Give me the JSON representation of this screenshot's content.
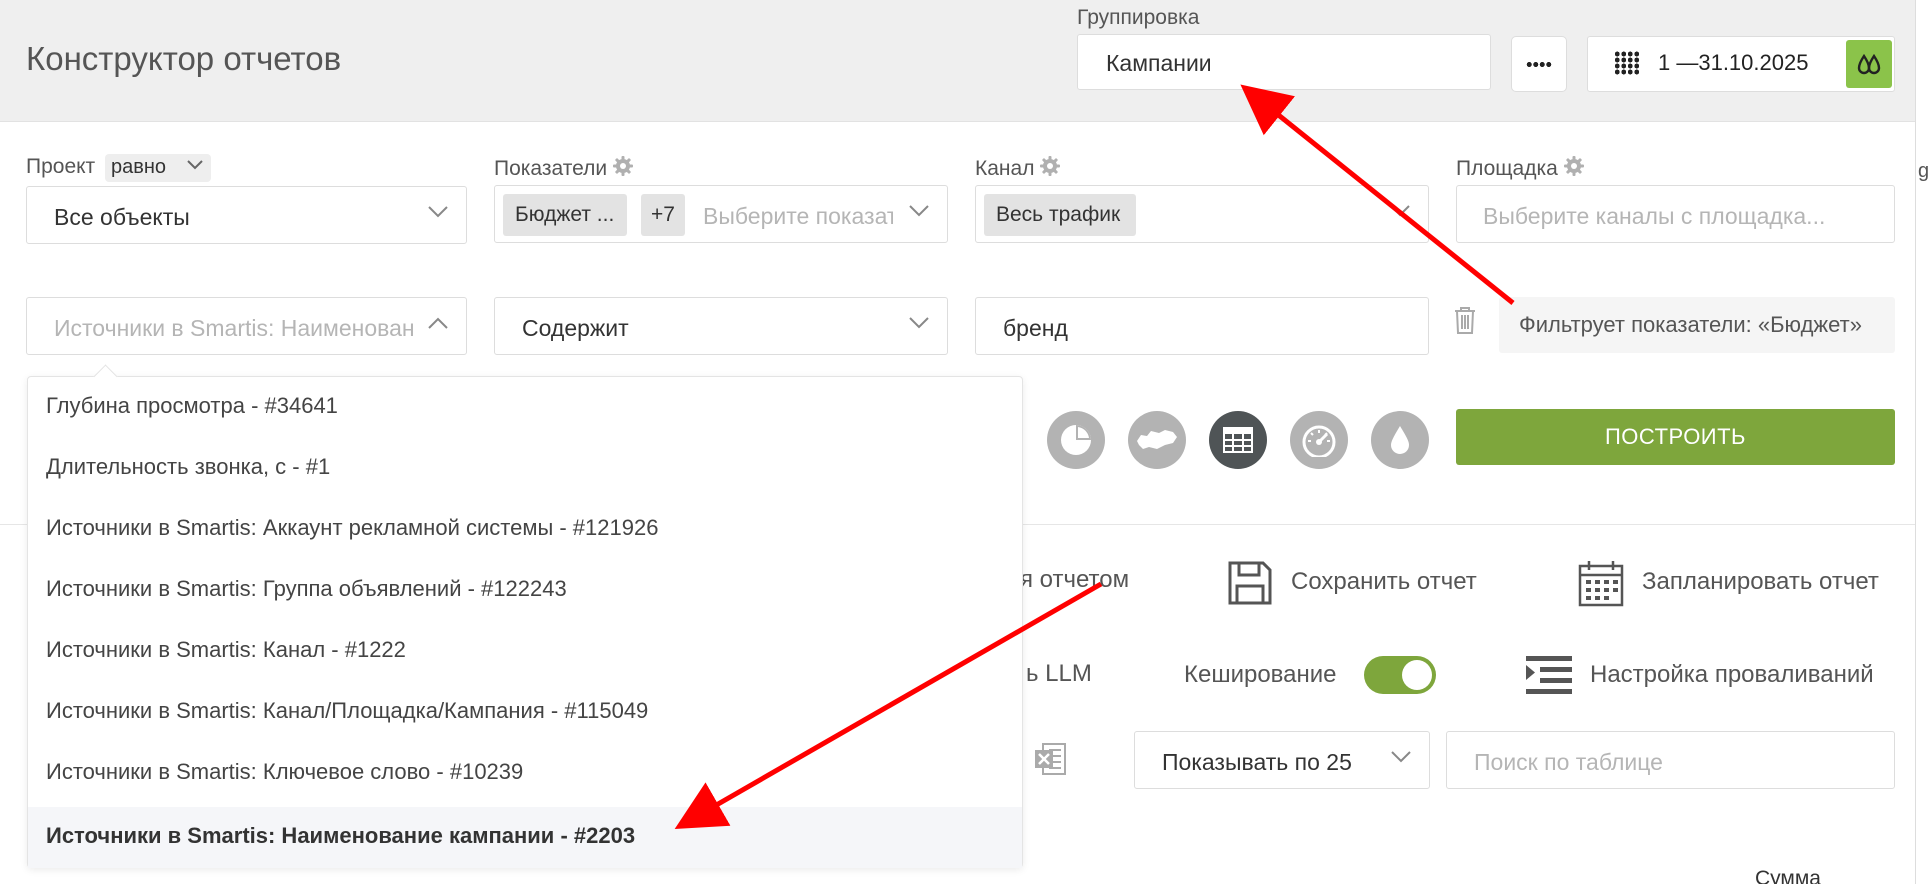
{
  "header": {
    "title": "Конструктор отчетов",
    "grouping_label": "Группировка",
    "grouping_value": "Кампании",
    "date_range": "1 —31.10.2025"
  },
  "filters": {
    "project": {
      "label": "Проект",
      "operator": "равно",
      "value": "Все объекты"
    },
    "metrics": {
      "label": "Показатели",
      "tag": "Бюджет ...",
      "more": "+7",
      "placeholder": "Выберите показатели"
    },
    "channel": {
      "label": "Канал",
      "tag": "Весь трафик"
    },
    "platform": {
      "label": "Площадка",
      "placeholder": "Выберите каналы с площадка..."
    },
    "condition": {
      "field_placeholder": "Источники в Smartis: Наименование кампании",
      "operator": "Содержит",
      "value": "бренд",
      "note": "Фильтрует показатели: «Бюджет»"
    }
  },
  "dropdown": {
    "options": [
      "Глубина просмотра - #34641",
      "Длительность звонка, с - #1",
      "Источники в Smartis: Аккаунт рекламной системы - #121926",
      "Источники в Smartis: Группа объявлений - #122243",
      "Источники в Smartis: Канал - #1222",
      "Источники в Smartis: Канал/Площадка/Кампания - #115049",
      "Источники в Smartis: Ключевое слово - #10239",
      "Источники в Smartis: Наименование кампании - #2203"
    ],
    "selected_index": 7
  },
  "view_modes": [
    "pie-chart",
    "map",
    "table",
    "gauge",
    "drop"
  ],
  "active_view": "table",
  "build_button": "ПОСТРОИТЬ",
  "actions": {
    "share_partial": "я отчетом",
    "save": "Сохранить отчет",
    "schedule": "Запланировать отчет",
    "llm_partial": "ь LLM",
    "caching": "Кеширование",
    "caching_enabled": true,
    "drilldown": "Настройка проваливаний"
  },
  "table_controls": {
    "page_size": "Показывать по 25",
    "search_placeholder": "Поиск по таблице",
    "column_sum": "Сумма"
  },
  "edge_char": "g",
  "colors": {
    "accent": "#7ea63c",
    "active_view": "#4f5456",
    "arrows": "#ff0000"
  }
}
